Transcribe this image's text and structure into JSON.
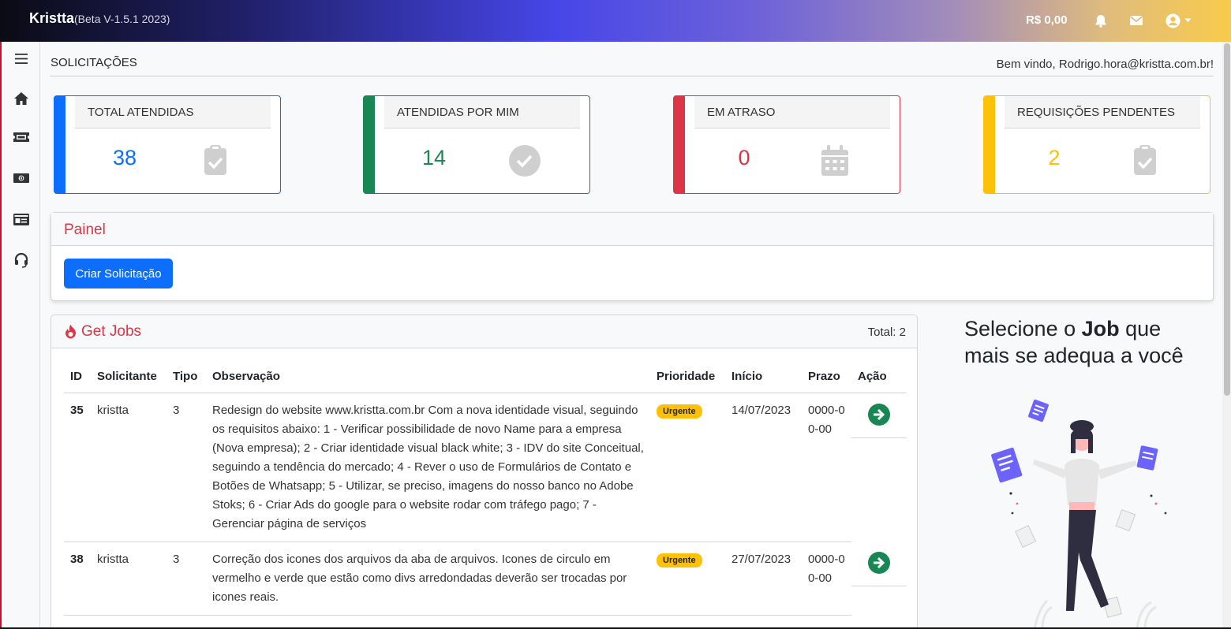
{
  "topbar": {
    "brand": "Kristta",
    "version": "(Beta V-1.5.1 2023)",
    "balance": "R$ 0,00"
  },
  "page": {
    "title": "SOLICITAÇÕES",
    "welcome": "Bem vindo, Rodrigo.hora@kristta.com.br!"
  },
  "stats": [
    {
      "label": "TOTAL ATENDIDAS",
      "value": "38",
      "color": "#0d6efd"
    },
    {
      "label": "ATENDIDAS POR MIM",
      "value": "14",
      "color": "#198754"
    },
    {
      "label": "EM ATRASO",
      "value": "0",
      "color": "#dc3545"
    },
    {
      "label": "REQUISIÇÕES PENDENTES",
      "value": "2",
      "color": "#ffc107"
    }
  ],
  "painel": {
    "title": "Painel",
    "create_button": "Criar Solicitação"
  },
  "jobs": {
    "title": "Get Jobs",
    "total": "Total: 2",
    "columns": [
      "ID",
      "Solicitante",
      "Tipo",
      "Observação",
      "Prioridade",
      "Início",
      "Prazo",
      "Ação"
    ],
    "rows": [
      {
        "id": "35",
        "requester": "kristta",
        "type": "3",
        "note": "Redesign do website www.kristta.com.br Com a nova identidade visual, seguindo os requisitos abaixo: 1 - Verificar possibilidade de novo Name para a empresa (Nova empresa); 2 - Criar identidade visual black white; 3 - IDV do site Conceitual, seguindo a tendência do mercado; 4 - Rever o uso de Formulários de Contato e Botões de Whatsapp; 5 - Utilizar, se preciso, imagens do nosso banco no Adobe Stoks; 6 - Criar Ads do google para o website rodar com tráfego pago; 7 - Gerenciar página de serviços",
        "priority": "Urgente",
        "start": "14/07/2023",
        "deadline": "0000-00-00"
      },
      {
        "id": "38",
        "requester": "kristta",
        "type": "3",
        "note": "Correção dos icones dos arquivos da aba de arquivos. Icones de circulo em vermelho e verde que estão como divs arredondadas deverão ser trocadas por icones reais.",
        "priority": "Urgente",
        "start": "27/07/2023",
        "deadline": "0000-00-00"
      }
    ]
  },
  "promo": {
    "pre": "Selecione o ",
    "bold": "Job",
    "post": " que mais se adequa a você"
  },
  "icons": {
    "sidebar": [
      "menu-icon",
      "home-icon",
      "ticket-icon",
      "money-icon",
      "id-card-icon",
      "headset-icon"
    ],
    "topbar": [
      "bell-icon",
      "envelope-icon",
      "user-circle-icon",
      "caret-down-icon"
    ]
  }
}
